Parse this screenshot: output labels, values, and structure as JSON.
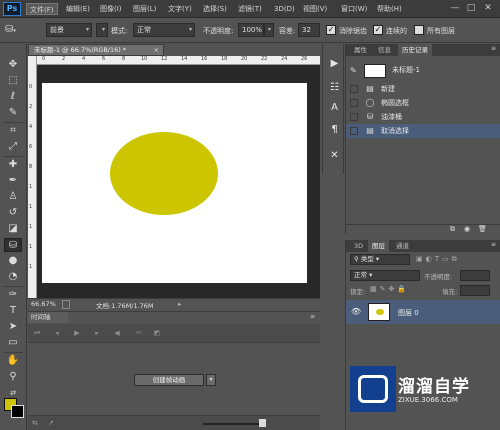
{
  "menubar": {
    "logo": "Ps",
    "items": [
      "文件(F)",
      "编辑(E)",
      "图像(I)",
      "图层(L)",
      "文字(Y)",
      "选择(S)",
      "滤镜(T)",
      "3D(D)",
      "视图(V)",
      "窗口(W)",
      "帮助(H)"
    ],
    "active_item": "文件(F)",
    "window_buttons": [
      "—",
      "□",
      "✕"
    ]
  },
  "options_bar": {
    "preset": "前景",
    "mode_label": "模式:",
    "mode_value": "正常",
    "opacity_label": "不透明度:",
    "opacity_value": "100%",
    "tolerance_label": "容差:",
    "tolerance_value": "32",
    "anti_alias_label": "消除锯齿",
    "anti_alias_checked": true,
    "contiguous_label": "连续的",
    "contiguous_checked": true,
    "all_layers_label": "所有图层",
    "all_layers_checked": false
  },
  "toolbar": {
    "tools": [
      "move-tool",
      "marquee-tool",
      "lasso-tool",
      "quick-select-tool",
      "crop-tool",
      "eyedropper-tool",
      "healing-brush-tool",
      "brush-tool",
      "clone-stamp-tool",
      "history-brush-tool",
      "eraser-tool",
      "paint-bucket-tool",
      "blur-tool",
      "dodge-tool",
      "pen-tool",
      "type-tool",
      "path-select-tool",
      "rectangle-tool",
      "hand-tool",
      "zoom-tool"
    ],
    "selected_tool": "paint-bucket-tool",
    "foreground_color": "#cdc500",
    "background_color": "#000000"
  },
  "document": {
    "tab_title": "未标题-1 @ 66.7%(RGB/16) *",
    "ruler_top_marks": [
      "0",
      "2",
      "4",
      "6",
      "8",
      "10",
      "12",
      "14",
      "16",
      "18",
      "20",
      "22",
      "24",
      "26"
    ],
    "ruler_left_marks": [
      "0",
      "2",
      "4",
      "6",
      "8",
      "1",
      "1",
      "1",
      "1",
      "1"
    ],
    "canvas_color": "#ffffff",
    "ellipse_color": "#cdc500",
    "zoom": "66.67%",
    "doc_info": "文档:1.76M/1.76M"
  },
  "timeline": {
    "tab_label": "时间轴",
    "create_button": "创建帧动画"
  },
  "history_panel": {
    "tabs": [
      "属性",
      "信息",
      "历史记录"
    ],
    "active_tab": "历史记录",
    "snapshot_label": "未标题-1",
    "items": [
      {
        "label": "新建",
        "icon": "document-icon",
        "selected": false
      },
      {
        "label": "椭圆选框",
        "icon": "ellipse-marquee-icon",
        "selected": false
      },
      {
        "label": "油漆桶",
        "icon": "paint-bucket-icon",
        "selected": false
      },
      {
        "label": "取消选择",
        "icon": "document-icon",
        "selected": true
      }
    ]
  },
  "layers_panel": {
    "tabs": [
      "3D",
      "图层",
      "通道"
    ],
    "active_tab": "图层",
    "filter": "类型",
    "blend_mode": "正常",
    "opacity_label": "不透明度:",
    "lock_label": "锁定:",
    "fill_label": "填充:",
    "layer_name": "图层 0"
  },
  "watermark": {
    "title": "溜溜自学",
    "subtitle": "ZIXUE.3066.COM"
  }
}
